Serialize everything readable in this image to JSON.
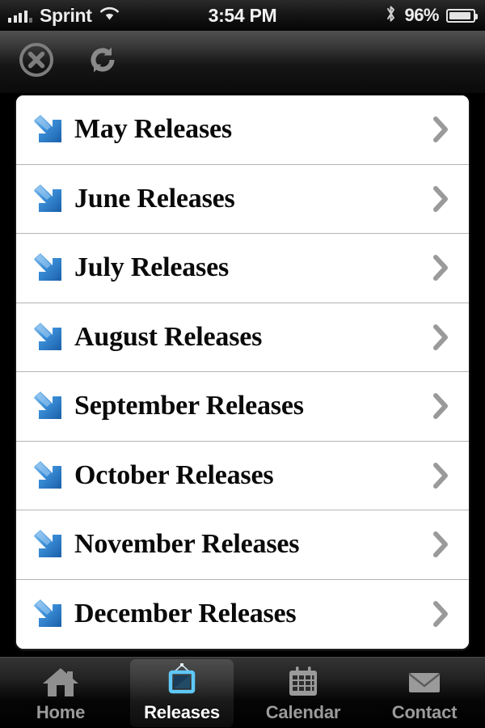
{
  "status_bar": {
    "carrier": "Sprint",
    "signal_icon": "signal-bars-icon",
    "wifi_icon": "wifi-icon",
    "time": "3:54 PM",
    "bluetooth_icon": "bluetooth-icon",
    "battery_percent": "96%",
    "battery_icon": "battery-icon"
  },
  "toolbar": {
    "close_icon": "close-circle-icon",
    "refresh_icon": "refresh-icon"
  },
  "list": {
    "row_icon": "blue-arrow-down-right-icon",
    "disclosure_icon": "chevron-right-icon",
    "rows": [
      {
        "label": "May Releases"
      },
      {
        "label": "June Releases"
      },
      {
        "label": "July Releases"
      },
      {
        "label": "August Releases"
      },
      {
        "label": "September Releases"
      },
      {
        "label": "October Releases"
      },
      {
        "label": "November Releases"
      },
      {
        "label": "December Releases"
      }
    ]
  },
  "tab_bar": {
    "tabs": [
      {
        "label": "Home",
        "icon": "house-icon",
        "active": false
      },
      {
        "label": "Releases",
        "icon": "picture-frame-icon",
        "active": true
      },
      {
        "label": "Calendar",
        "icon": "calendar-grid-icon",
        "active": false
      },
      {
        "label": "Contact",
        "icon": "envelope-icon",
        "active": false
      }
    ]
  },
  "colors": {
    "accent_blue": "#2f7fd4",
    "list_background": "#ffffff",
    "page_background": "#000000",
    "separator": "#b4b4b4",
    "tab_inactive_text": "#9b9b9b",
    "tab_active_text": "#ffffff"
  }
}
